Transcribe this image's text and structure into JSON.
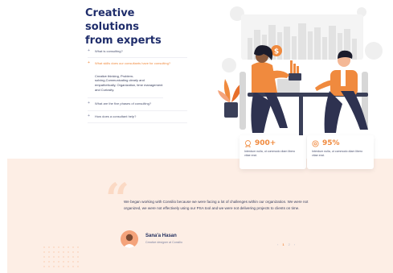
{
  "heading": {
    "line1": "Creative solutions",
    "line2": "from experts"
  },
  "faq": {
    "q1": "What is consulting?",
    "q2": "What skills does our consultants have for consulting?",
    "answer": "Creative thinking, Problem-solving,Communicating clearly and empathetically, Organization, time management and Curiosity.",
    "q3": "What are the five phases of consulting?",
    "q4": "How does a consultant help?"
  },
  "stats": [
    {
      "value": "900+",
      "icon": "trophy-icon",
      "text": "Interdum nulla, ut commodo diam libero vitae erat."
    },
    {
      "value": "95%",
      "icon": "target-icon",
      "text": "Interdum nulla, ut commodo diam libero vitae erat."
    }
  ],
  "testimonial": {
    "quote": "We began working with Consilio because we were facing a lot of challenges within our organization. We were not organized, we were not effectively using our PSA tool and we were not delivering projects to clients on time.",
    "name": "Sana'a Hasan",
    "role": "Creative designer at Consilio"
  },
  "pager": {
    "current": "1",
    "total": "2",
    "prev": "‹",
    "next": "›"
  },
  "colors": {
    "accent": "#f08a3e",
    "navy": "#1f2d6b",
    "band": "#fdeee5"
  }
}
